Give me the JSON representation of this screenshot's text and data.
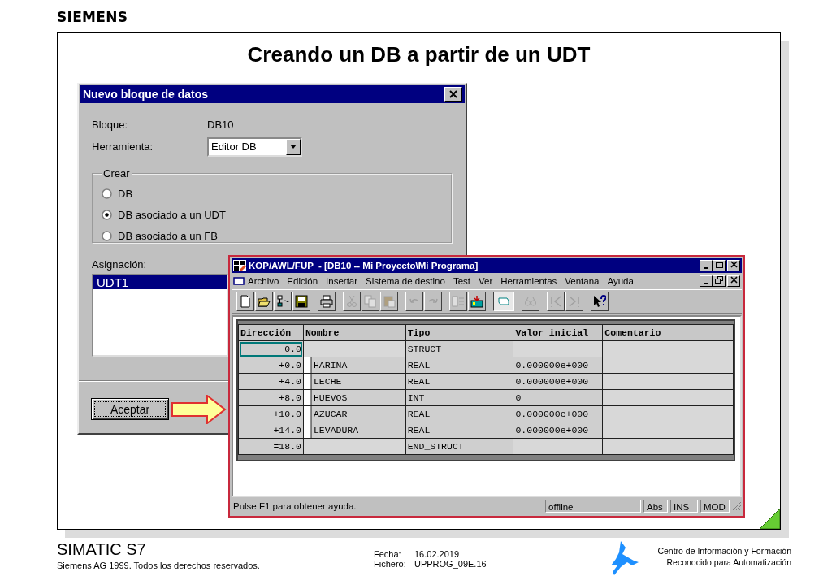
{
  "header": {
    "brand": "SIEMENS"
  },
  "slide": {
    "title": "Creando un DB a partir de un UDT"
  },
  "dialog": {
    "title": "Nuevo bloque de datos",
    "fields": [
      {
        "label": "Bloque:",
        "value": "DB10",
        "kind": "text"
      },
      {
        "label": "Herramienta:",
        "value": "Editor DB",
        "kind": "dropdown"
      }
    ],
    "group": {
      "title": "Crear",
      "options": [
        {
          "label": "DB",
          "selected": false
        },
        {
          "label": "DB asociado a un UDT",
          "selected": true
        },
        {
          "label": "DB asociado a un FB",
          "selected": false
        }
      ]
    },
    "assignment": {
      "label": "Asignación:",
      "items": [
        {
          "label": "UDT1",
          "selected": true
        }
      ]
    },
    "buttons": [
      "Aceptar"
    ]
  },
  "editor": {
    "title": "KOP/AWL/FUP  - [DB10 -- Mi Proyecto\\Mi Programa]",
    "menu": [
      "Archivo",
      "Edición",
      "Insertar",
      "Sistema de destino",
      "Test",
      "Ver",
      "Herramientas",
      "Ventana",
      "Ayuda"
    ],
    "toolbar": [
      [
        {
          "kind": "new",
          "disabled": false,
          "pressed": false
        },
        {
          "kind": "open",
          "disabled": false,
          "pressed": false
        },
        {
          "kind": "network",
          "disabled": false,
          "pressed": false
        },
        {
          "kind": "save",
          "disabled": false,
          "pressed": false
        }
      ],
      [
        {
          "kind": "print",
          "disabled": false,
          "pressed": false
        }
      ],
      [
        {
          "kind": "cut",
          "disabled": true,
          "pressed": false
        },
        {
          "kind": "copy",
          "disabled": true,
          "pressed": false
        },
        {
          "kind": "paste",
          "disabled": true,
          "pressed": false
        }
      ],
      [
        {
          "kind": "undo",
          "disabled": true,
          "pressed": false
        },
        {
          "kind": "redo",
          "disabled": true,
          "pressed": false
        }
      ],
      [
        {
          "kind": "compare",
          "disabled": true,
          "pressed": false
        },
        {
          "kind": "download",
          "disabled": false,
          "pressed": false
        }
      ],
      [
        {
          "kind": "monitor",
          "disabled": false,
          "pressed": true
        }
      ],
      [
        {
          "kind": "glasses",
          "disabled": true,
          "pressed": false
        }
      ],
      [
        {
          "kind": "prev",
          "disabled": true,
          "pressed": false
        },
        {
          "kind": "next",
          "disabled": true,
          "pressed": false
        }
      ],
      [
        {
          "kind": "help",
          "disabled": false,
          "pressed": false
        }
      ]
    ],
    "table": {
      "columns": [
        "Dirección",
        "Nombre",
        "Tipo",
        "Valor inicial",
        "Comentario"
      ],
      "rows": [
        {
          "kind": "struct",
          "focused": true,
          "address": "0.0",
          "type": "STRUCT"
        },
        {
          "kind": "member",
          "focused": false,
          "address": "+0.0",
          "name": "HARINA",
          "type": "REAL",
          "initial": "0.000000e+000"
        },
        {
          "kind": "member",
          "focused": false,
          "address": "+4.0",
          "name": "LECHE",
          "type": "REAL",
          "initial": "0.000000e+000"
        },
        {
          "kind": "member",
          "focused": false,
          "address": "+8.0",
          "name": "HUEVOS",
          "type": "INT",
          "initial": "0"
        },
        {
          "kind": "member",
          "focused": false,
          "address": "+10.0",
          "name": "AZUCAR",
          "type": "REAL",
          "initial": "0.000000e+000"
        },
        {
          "kind": "member",
          "focused": false,
          "address": "+14.0",
          "name": "LEVADURA",
          "type": "REAL",
          "initial": "0.000000e+000"
        },
        {
          "kind": "end",
          "focused": false,
          "address": "=18.0",
          "type": "END_STRUCT"
        }
      ]
    },
    "status_bar": {
      "message": "Pulse F1 para obtener ayuda.",
      "fields": [
        "offline",
        "Abs",
        "INS",
        "MOD"
      ]
    }
  },
  "footer": {
    "product": "SIMATIC S7",
    "copyright": "Siemens AG 1999. Todos los derechos reservados.",
    "date_label": "Fecha:",
    "date": "16.02.2019",
    "file_label": "Fichero:",
    "file": "UPPROG_09E.16",
    "center": [
      "Centro de Información y Formación",
      "Reconocido para Automatización"
    ]
  }
}
